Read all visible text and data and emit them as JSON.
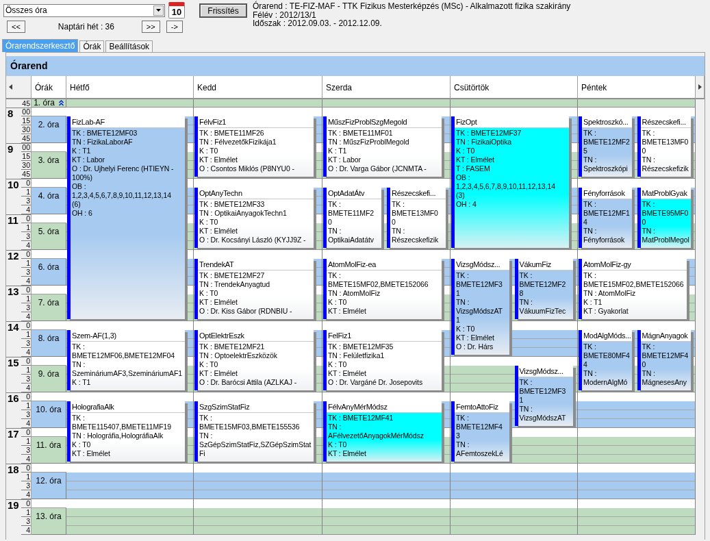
{
  "top_bar": {
    "select": {
      "value": "Összes óra"
    },
    "calendar_button": {
      "day": "10"
    },
    "prev_button": "<<",
    "week_label": "Naptári hét : 36",
    "next_button": ">>",
    "go_button": "->",
    "refresh_button": "Frissítés",
    "info": [
      "Órarend : TE-FIZ-MAF - TTK Fizikus Mesterképzés (MSc) - Alkalmazott fizika szakirány",
      "Félév : 2012/13/1",
      "Időszak : 2012.09.03. - 2012.12.09."
    ]
  },
  "tabs": [
    {
      "label": "Órarendszerkesztő",
      "selected": true
    },
    {
      "label": "Órák",
      "selected": false
    },
    {
      "label": "Beállítások",
      "selected": false
    }
  ],
  "timetable": {
    "title": "Órarend",
    "periods_heading": "Órák",
    "time_ruler": {
      "first": "45",
      "hours": [
        {
          "hour": "8",
          "minutes": [
            "00",
            "15",
            "30",
            "45"
          ]
        },
        {
          "hour": "9",
          "minutes": [
            "00",
            "15",
            "30",
            "45"
          ]
        },
        {
          "hour": "10",
          "minutes": [
            "0",
            "1",
            "3",
            "4"
          ]
        },
        {
          "hour": "11",
          "minutes": [
            "0",
            "1",
            "3",
            "4"
          ]
        },
        {
          "hour": "12",
          "minutes": [
            "0",
            "1",
            "3",
            "4"
          ]
        },
        {
          "hour": "13",
          "minutes": [
            "0",
            "1",
            "3",
            "4"
          ]
        },
        {
          "hour": "14",
          "minutes": [
            "0",
            "1",
            "3",
            "4"
          ]
        },
        {
          "hour": "15",
          "minutes": [
            "0",
            "1",
            "3",
            "4"
          ]
        },
        {
          "hour": "16",
          "minutes": [
            "0",
            "1",
            "3",
            "4"
          ]
        },
        {
          "hour": "17",
          "minutes": [
            "0",
            "1",
            "3",
            "4"
          ]
        },
        {
          "hour": "18",
          "minutes": [
            "0",
            "1",
            "3",
            "4"
          ]
        },
        {
          "hour": "19",
          "minutes": [
            "0",
            "1",
            "3",
            "4"
          ]
        }
      ]
    },
    "periods": [
      {
        "label": "1. óra",
        "kind": "cut",
        "color": "#c0dcc0"
      },
      {
        "label": "2. óra",
        "kind": "full",
        "color": "#a6caf0"
      },
      {
        "label": "3. óra",
        "kind": "full",
        "color": "#c0dcc0"
      },
      {
        "label": "4. óra",
        "kind": "full",
        "color": "#a6caf0"
      },
      {
        "label": "5. óra",
        "kind": "full",
        "color": "#c0dcc0"
      },
      {
        "label": "6. óra",
        "kind": "full",
        "color": "#a6caf0"
      },
      {
        "label": "7. óra",
        "kind": "full",
        "color": "#c0dcc0"
      },
      {
        "label": "8. óra",
        "kind": "full",
        "color": "#a6caf0"
      },
      {
        "label": "9. óra",
        "kind": "full",
        "color": "#c0dcc0"
      },
      {
        "label": "10. óra",
        "kind": "full",
        "color": "#a6caf0"
      },
      {
        "label": "11. óra",
        "kind": "full",
        "color": "#c0dcc0"
      },
      {
        "label": "12. óra",
        "kind": "full",
        "color": "#a6caf0"
      },
      {
        "label": "13. óra",
        "kind": "full",
        "color": "#c0dcc0"
      }
    ],
    "days": [
      {
        "name": "Hétfő",
        "slots": [
          {
            "cells": [
              {
                "kind": "empty"
              }
            ]
          },
          {
            "cells": [
              {
                "kind": "event",
                "title": "FizLab-AF",
                "color": "#a6caf0",
                "lines": [
                  "TK : BMETE12MF03",
                  "TN : FizikaLaborAF",
                  "K : T1",
                  "KT : Labor",
                  "O :  Dr. Ujhelyi Ferenc (HTIEYN -",
                  "100%)",
                  "OB :",
                  "1,2,3,4,5,6,7,8,9,10,11,12,13,14",
                  "(6)",
                  "OH : 6"
                ]
              }
            ]
          },
          {
            "cells": [
              {
                "kind": "continued"
              }
            ]
          },
          {
            "cells": [
              {
                "kind": "continued"
              }
            ]
          },
          {
            "cells": [
              {
                "kind": "continued"
              }
            ]
          },
          {
            "cells": [
              {
                "kind": "continued"
              }
            ]
          },
          {
            "cells": [
              {
                "kind": "continued"
              }
            ]
          },
          {
            "cells": [
              {
                "kind": "event",
                "title": "Szem-AF(1,3)",
                "color": "#ffffff",
                "lines": [
                  "TK :",
                  "BMETE12MF06,BMETE12MF04",
                  "TN :",
                  "SzemináriumAF3,SzemináriumAF1",
                  "K : T1"
                ]
              }
            ]
          },
          {
            "cells": [
              {
                "kind": "continued"
              }
            ]
          },
          {
            "cells": [
              {
                "kind": "event",
                "title": "HolografiaAlk",
                "color": "#ffffff",
                "lines": [
                  "TK :",
                  "BMETE115407,BMETE11MF19",
                  "TN : Holográfia,HolográfiaAlk",
                  "K : T0",
                  "KT : Elmélet"
                ]
              }
            ]
          },
          {
            "cells": [
              {
                "kind": "continued"
              }
            ]
          },
          {
            "cells": [
              {
                "kind": "empty"
              }
            ]
          },
          {
            "cells": [
              {
                "kind": "empty"
              }
            ]
          }
        ]
      },
      {
        "name": "Kedd",
        "slots": [
          {
            "cells": [
              {
                "kind": "empty"
              }
            ]
          },
          {
            "cells": [
              {
                "kind": "event",
                "title": "FélvFiz1",
                "color": "#ffffff",
                "lines": [
                  "TK : BMETE11MF26",
                  "TN : FélvezetőkFizikája1",
                  "K : T0",
                  "KT : Elmélet",
                  "O :  Csontos Miklós (P8NYU0 -"
                ]
              }
            ]
          },
          {
            "cells": [
              {
                "kind": "continued"
              }
            ]
          },
          {
            "cells": [
              {
                "kind": "event",
                "title": "OptAnyTechn",
                "color": "#ffffff",
                "lines": [
                  "TK : BMETE12MF33",
                  "TN : OptikaiAnyagokTechn1",
                  "K : T0",
                  "KT : Elmélet",
                  "O :  Dr. Kocsányi László (KYJJ9Z -"
                ]
              }
            ]
          },
          {
            "cells": [
              {
                "kind": "continued"
              }
            ]
          },
          {
            "cells": [
              {
                "kind": "event",
                "title": "TrendekAT",
                "color": "#ffffff",
                "lines": [
                  "TK : BMETE12MF27",
                  "TN : TrendekAnyagtud",
                  "K : T0",
                  "KT : Elmélet",
                  "O :  Dr. Kiss Gábor (RDNBIU -"
                ]
              }
            ]
          },
          {
            "cells": [
              {
                "kind": "continued"
              }
            ]
          },
          {
            "cells": [
              {
                "kind": "event",
                "title": "OptElektrEszk",
                "color": "#ffffff",
                "lines": [
                  "TK : BMETE12MF21",
                  "TN : OptoelektrEszközök",
                  "K : T0",
                  "KT : Elmélet",
                  "O :  Dr. Barócsi Attila (AZLKAJ -"
                ]
              }
            ]
          },
          {
            "cells": [
              {
                "kind": "continued"
              }
            ]
          },
          {
            "cells": [
              {
                "kind": "event",
                "title": "SzgSzimStatFiz",
                "color": "#ffffff",
                "lines": [
                  "TK :",
                  "BMETE15MF03,BMETE155536",
                  "TN :",
                  "SzGépSzimStatFiz,SZGépSzimStat",
                  "Fi"
                ]
              }
            ]
          },
          {
            "cells": [
              {
                "kind": "continued"
              }
            ]
          },
          {
            "cells": [
              {
                "kind": "empty"
              }
            ]
          },
          {
            "cells": [
              {
                "kind": "empty"
              }
            ]
          }
        ]
      },
      {
        "name": "Szerda",
        "slots": [
          {
            "cells": [
              {
                "kind": "empty"
              }
            ]
          },
          {
            "cells": [
              {
                "kind": "event",
                "title": "MűszFizProblSzgMegold",
                "color": "#ffffff",
                "lines": [
                  "TK : BMETE11MF01",
                  "TN : MűszFizProblMegold",
                  "K : T1",
                  "KT : Labor",
                  "O :  Dr. Varga Gábor (JCNMTA -"
                ]
              }
            ]
          },
          {
            "cells": [
              {
                "kind": "continued"
              }
            ]
          },
          {
            "cells": [
              {
                "kind": "event",
                "title": "OptAdatÁtv",
                "color": "#ffffff",
                "lines": [
                  "TK :",
                  "BMETE11MF2",
                  "0",
                  "TN :",
                  "OptikaiAdatátv"
                ]
              },
              {
                "kind": "event",
                "title": "Részecskefi...",
                "color": "#ffffff",
                "lines": [
                  "TK :",
                  "BMETE13MF0",
                  "0",
                  "TN :",
                  "Részecskefizik"
                ]
              }
            ]
          },
          {
            "cells": [
              {
                "kind": "continued"
              },
              {
                "kind": "continued"
              }
            ]
          },
          {
            "cells": [
              {
                "kind": "event",
                "title": "AtomMolFiz-ea",
                "color": "#ffffff",
                "lines": [
                  "TK :",
                  "BMETE15MF02,BMETE152066",
                  "TN : AtomMolFiz",
                  "K : T0",
                  "KT : Elmélet"
                ]
              }
            ]
          },
          {
            "cells": [
              {
                "kind": "continued"
              }
            ]
          },
          {
            "cells": [
              {
                "kind": "event",
                "title": "FelFiz1",
                "color": "#ffffff",
                "lines": [
                  "TK : BMETE12MF35",
                  "TN : Felületfizika1",
                  "K : T0",
                  "KT : Elmélet",
                  "O :  Dr. Vargáné Dr. Josepovits"
                ]
              }
            ]
          },
          {
            "cells": [
              {
                "kind": "continued"
              }
            ]
          },
          {
            "cells": [
              {
                "kind": "event",
                "title": "FélvAnyMérMódsz",
                "color": "#00ffff",
                "lines": [
                  "TK : BMETE12MF41",
                  "TN :",
                  "AFélvezetőAnyagokMérMódsz",
                  "K : T0",
                  "KT : Elmélet"
                ]
              }
            ]
          },
          {
            "cells": [
              {
                "kind": "continued"
              }
            ]
          },
          {
            "cells": [
              {
                "kind": "empty"
              }
            ]
          },
          {
            "cells": [
              {
                "kind": "empty"
              }
            ]
          }
        ]
      },
      {
        "name": "Csütörtök",
        "slots": [
          {
            "cells": [
              {
                "kind": "empty"
              }
            ]
          },
          {
            "cells": [
              {
                "kind": "event",
                "title": "FizOpt",
                "color": "#00ffff",
                "lines": [
                  "TK : BMETE12MF37",
                  "TN : FizikaiOptika",
                  "K : T0",
                  "KT : Elmélet",
                  "T : FASEM",
                  "OB :",
                  "1,2,3,4,5,6,7,8,9,10,11,12,13,14",
                  "(3)",
                  "OH : 4"
                ]
              }
            ]
          },
          {
            "cells": [
              {
                "kind": "continued"
              }
            ]
          },
          {
            "cells": [
              {
                "kind": "continued"
              }
            ]
          },
          {
            "cells": [
              {
                "kind": "continued"
              }
            ]
          },
          {
            "cells": [
              {
                "kind": "event",
                "title": "VizsgMódsz...",
                "color": "#a6caf0",
                "lines": [
                  "TK :",
                  "BMETE12MF3",
                  "1",
                  "TN :",
                  "VizsgMódszAT",
                  "1",
                  "K : T0",
                  "KT : Elmélet",
                  "O :  Dr. Hárs"
                ]
              },
              {
                "kind": "event",
                "title": "VákumFiz",
                "color": "#a6caf0",
                "lines": [
                  "TK :",
                  "BMETE12MF2",
                  "8",
                  "TN :",
                  "VákuumFizTec"
                ]
              }
            ]
          },
          {
            "cells": [
              {
                "kind": "continued"
              },
              {
                "kind": "continued"
              }
            ]
          },
          {
            "cells": [
              {
                "kind": "continued"
              },
              {
                "kind": "empty"
              }
            ]
          },
          {
            "cells": [
              {
                "kind": "empty"
              },
              {
                "kind": "event",
                "title": "VizsgMódsz...",
                "color": "#a6caf0",
                "lines": [
                  "TK :",
                  "BMETE12MF3",
                  "1",
                  "TN :",
                  "VizsgMódszAT"
                ]
              }
            ]
          },
          {
            "cells": [
              {
                "kind": "event",
                "title": "FemtoAttoFiz",
                "color": "#a6caf0",
                "lines": [
                  "TK :",
                  "BMETE12MF4",
                  "3",
                  "TN :",
                  "AFemtoszekLé"
                ]
              },
              {
                "kind": "continued"
              }
            ]
          },
          {
            "cells": [
              {
                "kind": "continued"
              },
              {
                "kind": "empty"
              }
            ]
          },
          {
            "cells": [
              {
                "kind": "empty"
              }
            ]
          },
          {
            "cells": [
              {
                "kind": "empty"
              }
            ]
          }
        ]
      },
      {
        "name": "Péntek",
        "slots": [
          {
            "cells": [
              {
                "kind": "empty"
              }
            ]
          },
          {
            "cells": [
              {
                "kind": "event",
                "title": "Spektroszkó...",
                "color": "#a6caf0",
                "lines": [
                  "TK :",
                  "BMETE12MF2",
                  "5",
                  "TN :",
                  "Spektroszkópi"
                ]
              },
              {
                "kind": "event",
                "title": "Részecskefi...",
                "color": "#ffffff",
                "lines": [
                  "TK :",
                  "BMETE13MF0",
                  "0",
                  "TN :",
                  "Részecskefizik"
                ]
              }
            ]
          },
          {
            "cells": [
              {
                "kind": "continued"
              },
              {
                "kind": "continued"
              }
            ]
          },
          {
            "cells": [
              {
                "kind": "event",
                "title": "Fényforrások",
                "color": "#a6caf0",
                "lines": [
                  "TK :",
                  "BMETE12MF1",
                  "4",
                  "TN :",
                  "Fényforrások"
                ]
              },
              {
                "kind": "event",
                "title": "MatProblGyak",
                "color": "#00ffff",
                "lines": [
                  "TK :",
                  "BMETE95MF0",
                  "0",
                  "TN :",
                  "MatProblMegol"
                ]
              }
            ]
          },
          {
            "cells": [
              {
                "kind": "continued"
              },
              {
                "kind": "continued"
              }
            ]
          },
          {
            "cells": [
              {
                "kind": "event",
                "title": "AtomMolFiz-gy",
                "color": "#ffffff",
                "lines": [
                  "TK :",
                  "BMETE15MF02,BMETE152066",
                  "TN : AtomMolFiz",
                  "K : T1",
                  "KT : Gyakorlat"
                ]
              }
            ]
          },
          {
            "cells": [
              {
                "kind": "continued"
              }
            ]
          },
          {
            "cells": [
              {
                "kind": "event",
                "title": "ModAlgMóds...",
                "color": "#a6caf0",
                "lines": [
                  "TK :",
                  "BMETE80MF4",
                  "4",
                  "TN :",
                  "ModernAlgMó"
                ]
              },
              {
                "kind": "event",
                "title": "MágnAnyagok",
                "color": "#a6caf0",
                "lines": [
                  "TK :",
                  "BMETE12MF4",
                  "0",
                  "TN :",
                  "MágnesesAny"
                ]
              }
            ]
          },
          {
            "cells": [
              {
                "kind": "continued"
              },
              {
                "kind": "continued"
              }
            ]
          },
          {
            "cells": [
              {
                "kind": "empty"
              }
            ]
          },
          {
            "cells": [
              {
                "kind": "empty"
              }
            ]
          },
          {
            "cells": [
              {
                "kind": "empty"
              }
            ]
          },
          {
            "cells": [
              {
                "kind": "empty"
              }
            ]
          }
        ]
      }
    ]
  }
}
